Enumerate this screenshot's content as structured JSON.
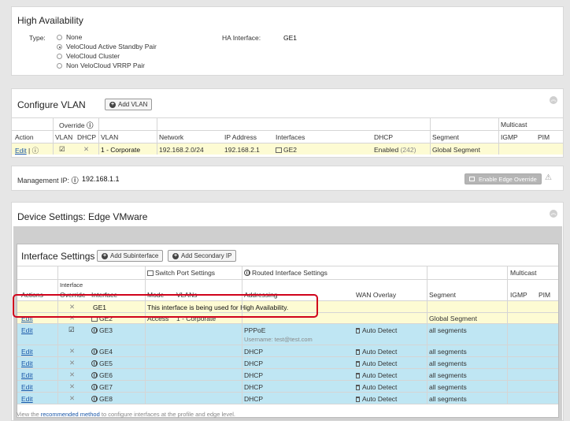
{
  "ha": {
    "title": "High Availability",
    "type_label": "Type:",
    "options": [
      "None",
      "VeloCloud Active Standby Pair",
      "VeloCloud Cluster",
      "Non VeloCloud VRRP Pair"
    ],
    "selected": 1,
    "iface_label": "HA Interface:",
    "iface_value": "GE1"
  },
  "vlan": {
    "title": "Configure VLAN",
    "add_btn": "Add VLAN",
    "hdr_override": "Override",
    "hdr_multicast": "Multicast",
    "cols": [
      "Action",
      "VLAN",
      "DHCP",
      "VLAN",
      "Network",
      "IP Address",
      "Interfaces",
      "DHCP",
      "Segment",
      "IGMP",
      "PIM"
    ],
    "row": {
      "edit": "Edit",
      "sep": "|",
      "vlan": "1 - Corporate",
      "network": "192.168.2.0/24",
      "ip": "192.168.2.1",
      "iface": "GE2",
      "dhcp": "Enabled",
      "dhcp_count": "(242)",
      "segment": "Global Segment"
    }
  },
  "mgmt": {
    "label": "Management IP:",
    "value": "192.168.1.1",
    "btn": "Enable Edge Override"
  },
  "device": {
    "title": "Device Settings: Edge VMware"
  },
  "iface": {
    "title": "Interface Settings",
    "add_sub_btn": "Add Subinterface",
    "add_sec_btn": "Add Secondary IP",
    "grp_switch": "Switch Port Settings",
    "grp_routed": "Routed Interface Settings",
    "grp_multicast": "Multicast",
    "hdr_interface_top": "Interface",
    "cols": [
      "Actions",
      "Override",
      "Interface",
      "Mode",
      "VLANs",
      "Addressing",
      "WAN Overlay",
      "Segment",
      "IGMP",
      "PIM"
    ],
    "ha_note": "This interface is being used for High Availability.",
    "rows": [
      {
        "edit": "",
        "iface": "GE1",
        "mode": "",
        "vlans": "",
        "addr": "",
        "user": "",
        "wan": "",
        "seg": ""
      },
      {
        "edit": "Edit",
        "iface": "GE2",
        "mode": "Access",
        "vlans": "1 - Corporate",
        "addr": "",
        "user": "",
        "wan": "",
        "seg": "Global Segment"
      },
      {
        "edit": "Edit",
        "iface": "GE3",
        "mode": "",
        "vlans": "",
        "addr": "PPPoE",
        "user": "Username: test@test.com",
        "wan": "Auto Detect",
        "seg": "all segments"
      },
      {
        "edit": "Edit",
        "iface": "GE4",
        "mode": "",
        "vlans": "",
        "addr": "DHCP",
        "user": "",
        "wan": "Auto Detect",
        "seg": "all segments"
      },
      {
        "edit": "Edit",
        "iface": "GE5",
        "mode": "",
        "vlans": "",
        "addr": "DHCP",
        "user": "",
        "wan": "Auto Detect",
        "seg": "all segments"
      },
      {
        "edit": "Edit",
        "iface": "GE6",
        "mode": "",
        "vlans": "",
        "addr": "DHCP",
        "user": "",
        "wan": "Auto Detect",
        "seg": "all segments"
      },
      {
        "edit": "Edit",
        "iface": "GE7",
        "mode": "",
        "vlans": "",
        "addr": "DHCP",
        "user": "",
        "wan": "Auto Detect",
        "seg": "all segments"
      },
      {
        "edit": "Edit",
        "iface": "GE8",
        "mode": "",
        "vlans": "",
        "addr": "DHCP",
        "user": "",
        "wan": "Auto Detect",
        "seg": "all segments"
      }
    ],
    "footer_pre": "View the",
    "footer_link": "recommended method",
    "footer_post": "to configure interfaces at the profile and edge level."
  },
  "colors": {
    "highlight": "#fdfbd3",
    "row_blue": "#bfe6f3",
    "callout": "#d0021b"
  }
}
